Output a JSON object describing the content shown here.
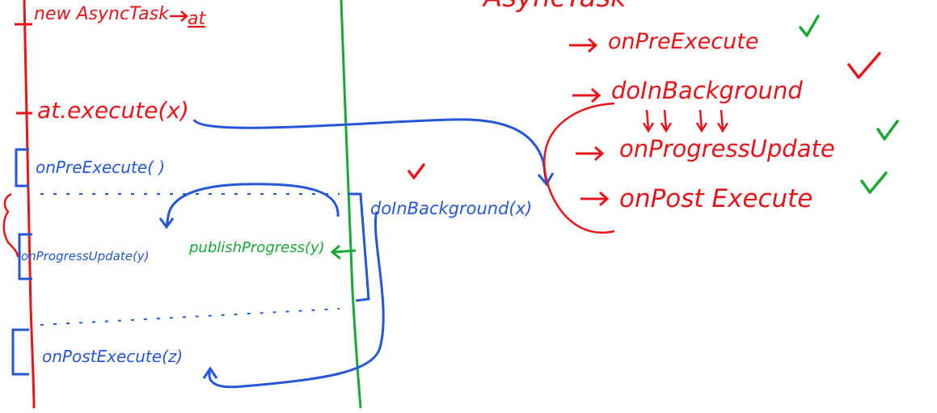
{
  "main_thread": {
    "new_task": "new AsyncTask",
    "ref": "at",
    "execute_call": "at.execute(x)",
    "on_pre_execute": "onPreExecute( )",
    "on_progress_update": "onProgressUpdate(y)",
    "on_post_execute": "onPostExecute(z)"
  },
  "background_thread": {
    "publish_progress": "publishProgress(y)",
    "do_in_background": "doInBackground(x)"
  },
  "lifecycle": {
    "title": "AsyncTask",
    "steps": [
      {
        "label": "onPreExecute",
        "check": "green"
      },
      {
        "label": "doInBackground",
        "check": "red"
      },
      {
        "label": "onProgressUpdate",
        "check": "green"
      },
      {
        "label": "onPost Execute",
        "check": "green"
      }
    ]
  },
  "colors": {
    "main_thread_line": "#e8141b",
    "background_thread_line": "#18a836",
    "flow_arrows": "#2456d6",
    "lifecycle_text": "#e8141b",
    "checkmark": "#18a836"
  }
}
